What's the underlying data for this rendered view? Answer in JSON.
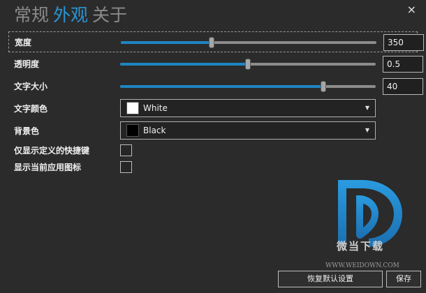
{
  "tabs": [
    {
      "label": "常规",
      "active": false
    },
    {
      "label": "外观",
      "active": true
    },
    {
      "label": "关于",
      "active": false
    }
  ],
  "close_glyph": "×",
  "settings": {
    "width": {
      "label": "宽度",
      "value": "350",
      "fraction": 0.355
    },
    "opacity": {
      "label": "透明度",
      "value": "0.5",
      "fraction": 0.5
    },
    "font_size": {
      "label": "文字大小",
      "value": "40",
      "fraction": 0.795
    },
    "text_color": {
      "label": "文字颜色",
      "selected": "White",
      "swatch": "#ffffff"
    },
    "background_color": {
      "label": "背景色",
      "selected": "Black",
      "swatch": "#000000"
    },
    "only_custom_shortcuts": {
      "label": "仅显示定义的快捷键",
      "checked": false
    },
    "show_app_icon": {
      "label": "显示当前应用图标",
      "checked": false
    }
  },
  "watermark": {
    "name": "微当下载",
    "url": "WWW.WEIDOWN.COM"
  },
  "buttons": {
    "reset": "恢复默认设置",
    "save": "保存"
  },
  "colors": {
    "accent": "#2a96d6",
    "slider_fill": "#1f85c2",
    "background": "#2b2b2b"
  }
}
